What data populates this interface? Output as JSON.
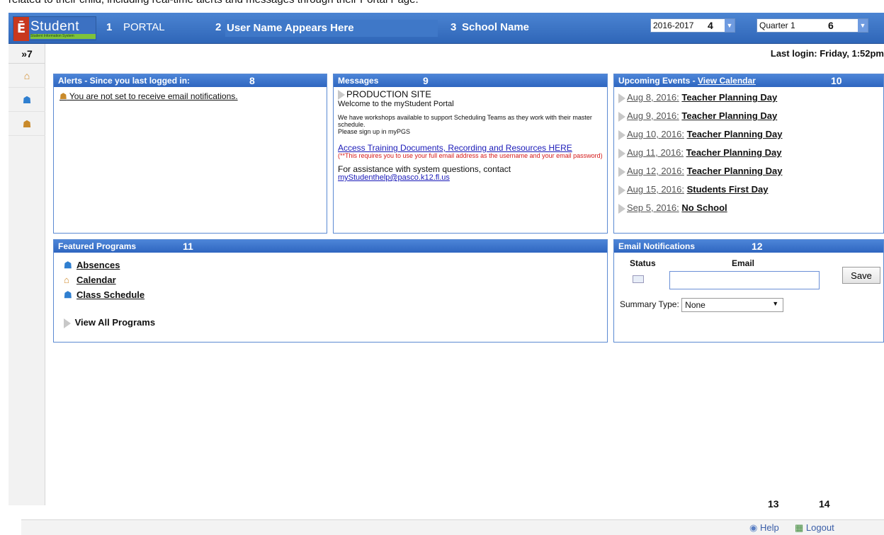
{
  "caption": "related to their child, including real-time alerts and messages through their Portal Page.",
  "header": {
    "logo_letter": "Ē",
    "logo_word": "Student",
    "logo_sub": "Student Information System",
    "portal_num": "1",
    "portal_label": "PORTAL",
    "username_num": "2",
    "username": "User Name Appears Here",
    "school_num": "3",
    "school": "School Name",
    "year_value": "2016-2017",
    "year_num": "4",
    "quarter_value": "Quarter 1",
    "quarter_num": "6"
  },
  "sidebar": {
    "expand": "»",
    "expand_num": "7"
  },
  "last_login": "Last login: Friday, 1:52pm",
  "alerts": {
    "title": "Alerts - Since you last logged in:",
    "num": "8",
    "message": "You are not set to receive email notifications."
  },
  "messages": {
    "title": "Messages",
    "num": "9",
    "heading": "PRODUCTION SITE",
    "welcome": "Welcome to the myStudent Portal",
    "workshop1": "We have workshops available to support Scheduling Teams as they work with their master schedule.",
    "workshop2": "Please sign up in myPGS",
    "link": "Access Training Documents, Recording and Resources HERE",
    "warning": "(**This requires you to use your full email address as the username and your email password)",
    "contact": "For assistance with system questions, contact",
    "contact_email": "myStudenthelp@pasco.k12.fl.us"
  },
  "events": {
    "title": "Upcoming Events - ",
    "calendar_link": "View Calendar",
    "num": "10",
    "items": [
      {
        "date": "Aug 8, 2016:",
        "name": "Teacher Planning Day"
      },
      {
        "date": "Aug 9, 2016:",
        "name": "Teacher Planning Day"
      },
      {
        "date": "Aug 10, 2016:",
        "name": "Teacher Planning Day"
      },
      {
        "date": "Aug 11, 2016:",
        "name": "Teacher Planning Day"
      },
      {
        "date": "Aug 12, 2016:",
        "name": "Teacher Planning Day"
      },
      {
        "date": "Aug 15, 2016:",
        "name": "Students First Day"
      },
      {
        "date": "Sep 5, 2016:",
        "name": "No School"
      }
    ]
  },
  "featured": {
    "title": "Featured Programs",
    "num": "11",
    "items": [
      {
        "label": "Absences",
        "icon": "person-icon"
      },
      {
        "label": "Calendar",
        "icon": "house-icon"
      },
      {
        "label": "Class Schedule",
        "icon": "person-icon"
      }
    ],
    "view_all": "View All Programs"
  },
  "email": {
    "title": "Email Notifications",
    "num": "12",
    "status_label": "Status",
    "email_label": "Email",
    "email_value": "",
    "save_label": "Save",
    "summary_label": "Summary Type:",
    "summary_value": "None"
  },
  "footer": {
    "help_num": "13",
    "help": "Help",
    "logout_num": "14",
    "logout": "Logout"
  }
}
